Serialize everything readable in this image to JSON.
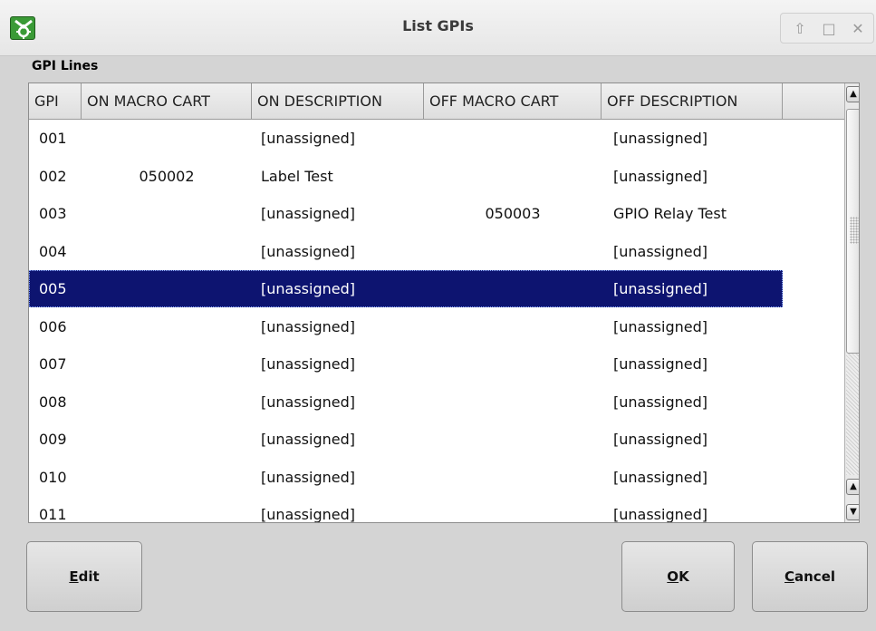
{
  "window": {
    "title": "List GPIs",
    "controls": {
      "up": "⇧",
      "maximize": "□",
      "close": "✕"
    }
  },
  "section": {
    "label": "GPI Lines"
  },
  "table": {
    "columns": [
      "GPI",
      "ON MACRO CART",
      "ON DESCRIPTION",
      "OFF MACRO CART",
      "OFF DESCRIPTION"
    ],
    "rows": [
      {
        "gpi": "001",
        "on_cart": "",
        "on_desc": "[unassigned]",
        "off_cart": "",
        "off_desc": "[unassigned]"
      },
      {
        "gpi": "002",
        "on_cart": "050002",
        "on_desc": "Label Test",
        "off_cart": "",
        "off_desc": "[unassigned]"
      },
      {
        "gpi": "003",
        "on_cart": "",
        "on_desc": "[unassigned]",
        "off_cart": "050003",
        "off_desc": "GPIO Relay Test"
      },
      {
        "gpi": "004",
        "on_cart": "",
        "on_desc": "[unassigned]",
        "off_cart": "",
        "off_desc": "[unassigned]"
      },
      {
        "gpi": "005",
        "on_cart": "",
        "on_desc": "[unassigned]",
        "off_cart": "",
        "off_desc": "[unassigned]"
      },
      {
        "gpi": "006",
        "on_cart": "",
        "on_desc": "[unassigned]",
        "off_cart": "",
        "off_desc": "[unassigned]"
      },
      {
        "gpi": "007",
        "on_cart": "",
        "on_desc": "[unassigned]",
        "off_cart": "",
        "off_desc": "[unassigned]"
      },
      {
        "gpi": "008",
        "on_cart": "",
        "on_desc": "[unassigned]",
        "off_cart": "",
        "off_desc": "[unassigned]"
      },
      {
        "gpi": "009",
        "on_cart": "",
        "on_desc": "[unassigned]",
        "off_cart": "",
        "off_desc": "[unassigned]"
      },
      {
        "gpi": "010",
        "on_cart": "",
        "on_desc": "[unassigned]",
        "off_cart": "",
        "off_desc": "[unassigned]"
      },
      {
        "gpi": "011",
        "on_cart": "",
        "on_desc": "[unassigned]",
        "off_cart": "",
        "off_desc": "[unassigned]"
      }
    ],
    "selected_gpi": "005"
  },
  "scrollbar": {
    "up_arrow": "▲",
    "down_arrow": "▼"
  },
  "buttons": {
    "edit": {
      "mnemonic": "E",
      "rest": "dit"
    },
    "ok": {
      "mnemonic": "O",
      "rest": "K"
    },
    "cancel": {
      "mnemonic": "C",
      "rest": "ancel"
    }
  },
  "colors": {
    "selection": "#0d1470",
    "app_icon": "#3a9a36"
  }
}
